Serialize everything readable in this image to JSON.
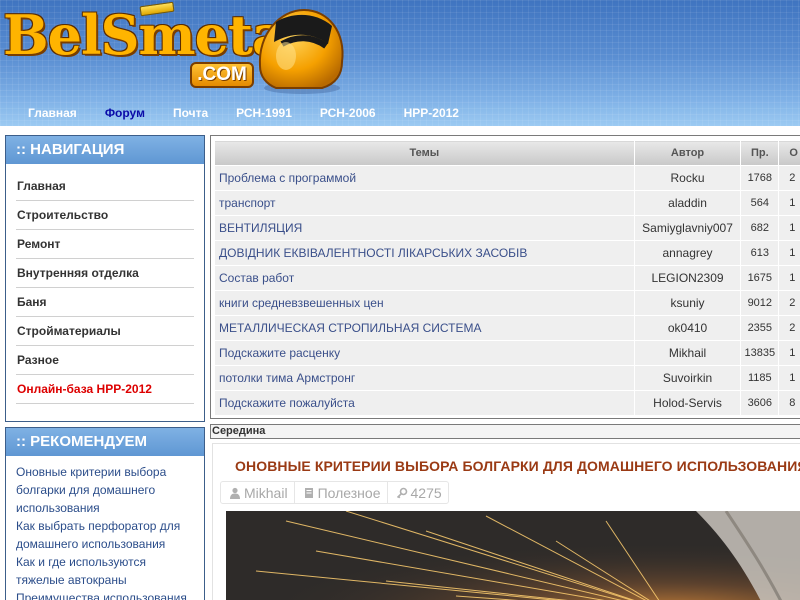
{
  "site": {
    "logo_text": "BelSmeta",
    "logo_suffix": ".COM"
  },
  "topnav": [
    {
      "label": "Главная",
      "active": false
    },
    {
      "label": "Форум",
      "active": true
    },
    {
      "label": "Почта",
      "active": false
    },
    {
      "label": "РСН-1991",
      "active": false
    },
    {
      "label": "РСН-2006",
      "active": false
    },
    {
      "label": "НРР-2012",
      "active": false
    }
  ],
  "navigation": {
    "title": ":: НАВИГАЦИЯ",
    "items": [
      "Главная",
      "Строительство",
      "Ремонт",
      "Внутренняя отделка",
      "Баня",
      "Стройматериалы",
      "Разное",
      "Онлайн-база НРР-2012"
    ],
    "highlight_color": "#dd0000"
  },
  "recommend": {
    "title": ":: РЕКОМЕНДУЕМ",
    "items": [
      "Оновные критерии выбора болгарки для домашнего использования",
      "Как выбрать перфоратор для домашнего использования",
      "Как и где используются тяжелые автокраны",
      "Преимущества использования"
    ]
  },
  "forum": {
    "headers": [
      "Темы",
      "Автор",
      "Пр.",
      "О"
    ],
    "rows": [
      {
        "topic": "Проблема с программой",
        "author": "Rocku",
        "views": "1768",
        "replies": "2"
      },
      {
        "topic": "транспорт",
        "author": "aladdin",
        "views": "564",
        "replies": "1"
      },
      {
        "topic": "ВЕНТИЛЯЦИЯ",
        "author": "Samiyglavniy007",
        "views": "682",
        "replies": "1"
      },
      {
        "topic": "ДОВІДНИК ЕКВІВАЛЕНТНОСТІ ЛІКАРСЬКИХ ЗАСОБІВ",
        "author": "annagrey",
        "views": "613",
        "replies": "1"
      },
      {
        "topic": "Состав работ",
        "author": "LEGION2309",
        "views": "1675",
        "replies": "1"
      },
      {
        "topic": "книги средневзвешенных цен",
        "author": "ksuniy",
        "views": "9012",
        "replies": "2"
      },
      {
        "topic": "МЕТАЛЛИЧЕСКАЯ СТРОПИЛЬНАЯ СИСТЕМА",
        "author": "ok0410",
        "views": "2355",
        "replies": "2"
      },
      {
        "topic": "Подскажите расценку",
        "author": "Mikhail",
        "views": "13835",
        "replies": "1"
      },
      {
        "topic": "потолки тима Армстронг",
        "author": "Suvoirkin",
        "views": "1185",
        "replies": "1"
      },
      {
        "topic": "Подскажите пожалуйста",
        "author": "Holod-Servis",
        "views": "3606",
        "replies": "8"
      }
    ]
  },
  "middle": {
    "header": "Середина",
    "article": {
      "title": "ОНОВНЫЕ КРИТЕРИИ ВЫБОРА БОЛГАРКИ ДЛЯ ДОМАШНЕГО ИСПОЛЬЗОВАНИЯ",
      "author": "Mikhail",
      "category": "Полезное",
      "views": "4275"
    }
  },
  "icons": {
    "user": "user-icon",
    "category": "document-icon",
    "views": "key-icon"
  },
  "colors": {
    "accent": "#5f97d3",
    "title_brown": "#9a3a14",
    "link_blue": "#2b4d8a",
    "nav_active": "#0a0aa8"
  }
}
